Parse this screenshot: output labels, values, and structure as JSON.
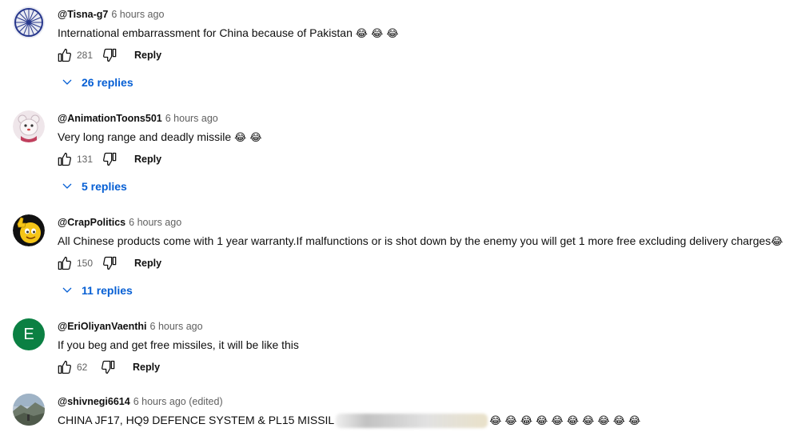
{
  "comments": [
    {
      "author": "@Tisna-g7",
      "time": "6 hours ago",
      "edited": "",
      "text": "International embarrassment for China because of Pakistan",
      "emojis": "😂 😂 😂",
      "likes": "281",
      "reply_label": "Reply",
      "replies_label": "26 replies",
      "avatar_icon": "ashoka-chakra-avatar"
    },
    {
      "author": "@AnimationToons501",
      "time": "6 hours ago",
      "edited": "",
      "text": "Very long range and deadly missile",
      "emojis": "😂 😂",
      "likes": "131",
      "reply_label": "Reply",
      "replies_label": "5 replies",
      "avatar_icon": "cartoon-bear-avatar"
    },
    {
      "author": "@CrapPolitics",
      "time": "6 hours ago",
      "edited": "",
      "text": "All Chinese products come with 1 year warranty.If malfunctions or is shot down by the enemy you will get 1 more free excluding delivery charges",
      "emojis": "😂",
      "likes": "150",
      "reply_label": "Reply",
      "replies_label": "11 replies",
      "avatar_icon": "thumbs-up-emoji-avatar"
    },
    {
      "author": "@EriOliyanVaenthi",
      "time": "6 hours ago",
      "edited": "",
      "text": "If you beg and get free missiles, it will be like this",
      "emojis": "",
      "likes": "62",
      "reply_label": "Reply",
      "replies_label": "",
      "avatar_letter": "E",
      "avatar_icon": "letter-avatar"
    },
    {
      "author": "@shivnegi6614",
      "time": "6 hours ago",
      "edited": "(edited)",
      "text": "CHINA JF17, HQ9 DEFENCE SYSTEM & PL15 MISSIL",
      "emojis": "😂 😂 😂 😂 😂 😂 😂 😂 😂 😂",
      "likes": "",
      "reply_label": "",
      "replies_label": "",
      "avatar_icon": "landscape-photo-avatar"
    }
  ],
  "colors": {
    "link_blue": "#065fd4",
    "muted_text": "#606060",
    "letter_avatar_bg": "#0b8043"
  }
}
